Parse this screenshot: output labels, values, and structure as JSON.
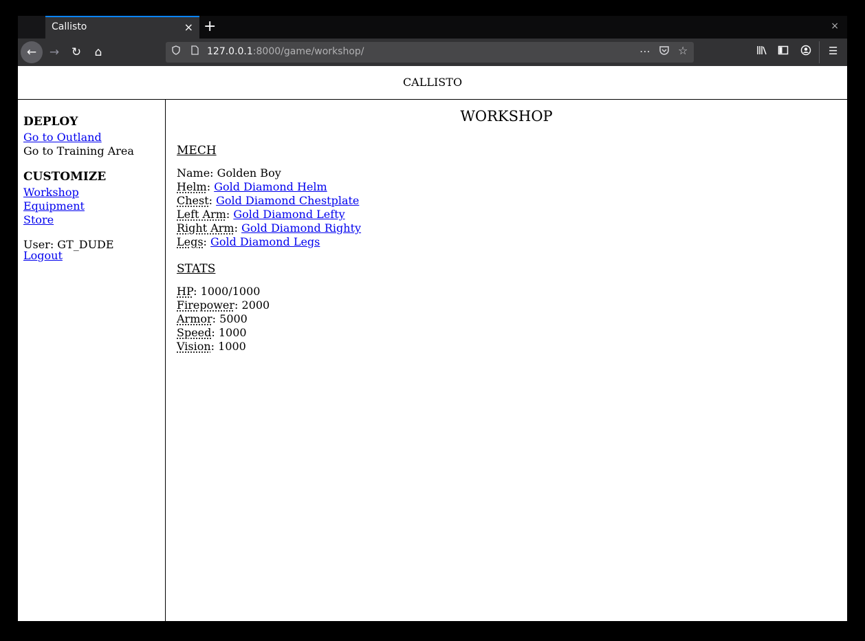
{
  "browser": {
    "tab_title": "Callisto",
    "tab_close": "×",
    "new_tab": "+",
    "window_close": "×",
    "url_host": "127.0.0.1",
    "url_rest": ":8000/game/workshop/",
    "icons": {
      "back": "back-arrow-icon",
      "forward": "forward-arrow-icon",
      "reload": "reload-icon",
      "home": "home-icon",
      "shield": "shield-icon",
      "page": "page-icon",
      "more": "more-actions-icon",
      "pocket": "pocket-icon",
      "bookmark": "star-icon",
      "library": "library-icon",
      "sidebar": "sidebar-toggle-icon",
      "account": "account-icon",
      "menu": "hamburger-menu-icon"
    },
    "accent": "#0a84ff"
  },
  "site": {
    "title": "CALLISTO"
  },
  "sidebar": {
    "deploy_heading": "DEPLOY",
    "go_outland": "Go to Outland",
    "go_training": "Go to Training Area",
    "customize_heading": "CUSTOMIZE",
    "workshop": "Workshop",
    "equipment": "Equipment",
    "store": "Store",
    "user_text": "User: GT_DUDE",
    "logout": "Logout"
  },
  "main": {
    "title": "WORKSHOP",
    "mech_heading": "MECH",
    "name_label": "Name:",
    "name_value": "Golden Boy",
    "helm_label": "Helm",
    "helm_value": "Gold Diamond Helm",
    "chest_label": "Chest",
    "chest_value": "Gold Diamond Chestplate",
    "left_arm_label": "Left Arm",
    "left_arm_value": "Gold Diamond Lefty",
    "right_arm_label": "Right Arm",
    "right_arm_value": "Gold Diamond Righty",
    "legs_label": "Legs",
    "legs_value": "Gold Diamond Legs",
    "stats_heading": "STATS",
    "hp_label": "HP",
    "hp_value": "1000/1000",
    "firepower_label": "Firepower",
    "firepower_value": "2000",
    "armor_label": "Armor",
    "armor_value": "5000",
    "speed_label": "Speed",
    "speed_value": "1000",
    "vision_label": "Vision",
    "vision_value": "1000"
  }
}
